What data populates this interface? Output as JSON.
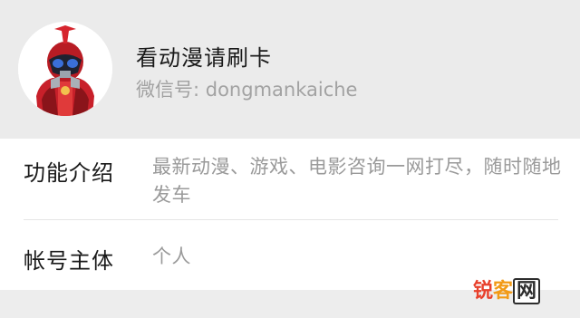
{
  "profile": {
    "name": "看动漫请刷卡",
    "wechat_id": "微信号: dongmankaiche"
  },
  "details": {
    "function_label": "功能介绍",
    "function_value": "最新动漫、游戏、电影咨询一网打尽，随时随地发车",
    "entity_label": "帐号主体",
    "entity_value": "个人"
  },
  "watermark": {
    "part1": "锐",
    "part2": "客",
    "part3": "网"
  },
  "colors": {
    "header_bg": "#ebebeb",
    "card_bg": "#ffffff",
    "primary_text": "#191919",
    "secondary_text": "#9a9a9a",
    "avatar_red": "#d62828"
  }
}
